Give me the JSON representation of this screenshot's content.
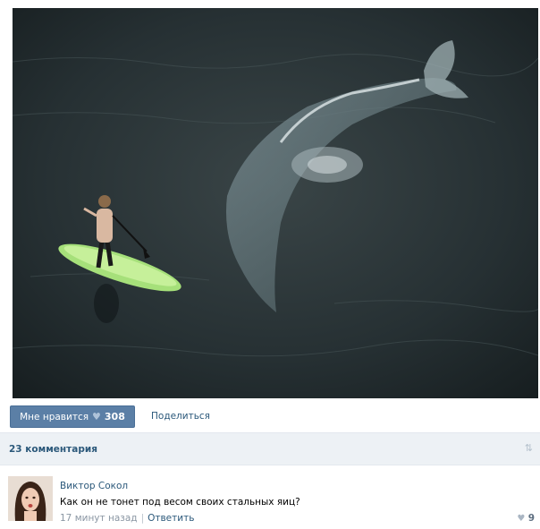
{
  "post": {
    "like_label": "Мне нравится",
    "like_count": "308",
    "share_label": "Поделиться"
  },
  "comments": {
    "header": "23 комментария",
    "items": [
      {
        "author": "Виктор Сокол",
        "text": "Как он не тонет под весом своих стальных яиц?",
        "time": "17 минут назад",
        "reply_label": "Ответить",
        "likes": "9"
      }
    ]
  },
  "icons": {
    "like": "heart-icon",
    "sort": "sort-arrows-icon"
  },
  "colors": {
    "accent": "#5b7fa6",
    "link": "#2b587a",
    "bar_bg": "#edf1f5"
  }
}
